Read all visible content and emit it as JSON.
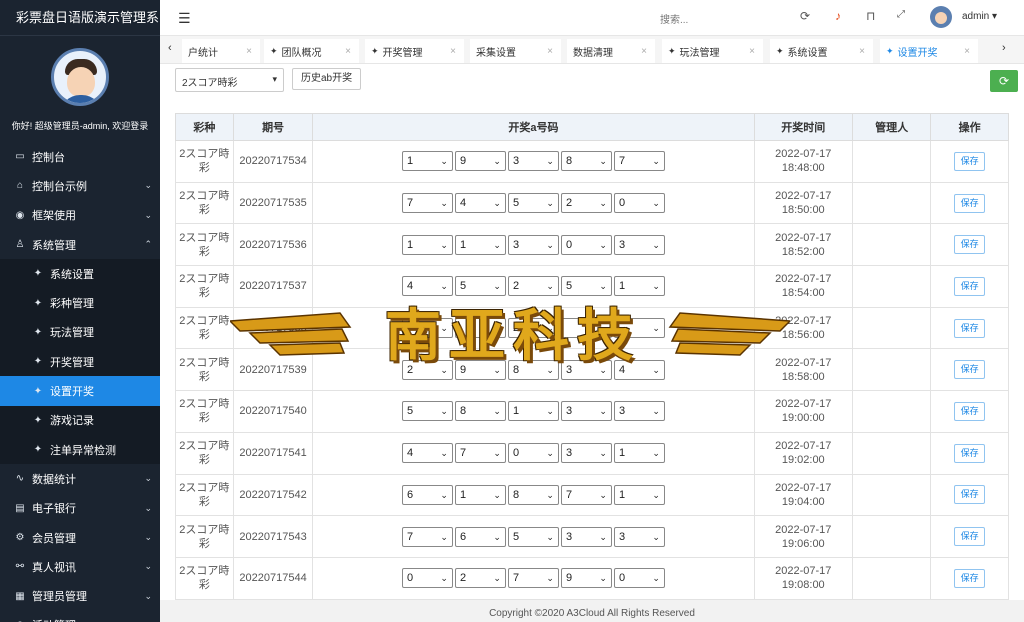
{
  "app": {
    "title": "彩票盘日语版演示管理系"
  },
  "sidebar": {
    "welcome": "你好! 超级管理员-admin, 欢迎登录",
    "items": [
      {
        "label": "控制台",
        "icon": "monitor-icon",
        "glyph": "▭",
        "arrow": ""
      },
      {
        "label": "控制台示例",
        "icon": "home-icon",
        "glyph": "⌂",
        "arrow": "⌄"
      },
      {
        "label": "框架使用",
        "icon": "toggle-icon",
        "glyph": "◉",
        "arrow": "⌄"
      },
      {
        "label": "系统管理",
        "icon": "user-icon",
        "glyph": "♙",
        "arrow": "⌃"
      },
      {
        "label": "系统设置",
        "icon": "gear-icon",
        "glyph": "✦",
        "arrow": "",
        "sub": true
      },
      {
        "label": "彩种管理",
        "icon": "gear-icon",
        "glyph": "✦",
        "arrow": "",
        "sub": true
      },
      {
        "label": "玩法管理",
        "icon": "gear-icon",
        "glyph": "✦",
        "arrow": "",
        "sub": true
      },
      {
        "label": "开奖管理",
        "icon": "gear-icon",
        "glyph": "✦",
        "arrow": "",
        "sub": true
      },
      {
        "label": "设置开奖",
        "icon": "gear-icon",
        "glyph": "✦",
        "arrow": "",
        "sub": true,
        "active": true
      },
      {
        "label": "游戏记录",
        "icon": "gear-icon",
        "glyph": "✦",
        "arrow": "",
        "sub": true
      },
      {
        "label": "注单异常检测",
        "icon": "gear-icon",
        "glyph": "✦",
        "arrow": "",
        "sub": true
      },
      {
        "label": "数据统计",
        "icon": "pulse-icon",
        "glyph": "∿",
        "arrow": "⌄"
      },
      {
        "label": "电子银行",
        "icon": "bank-icon",
        "glyph": "▤",
        "arrow": "⌄"
      },
      {
        "label": "会员管理",
        "icon": "settings-icon",
        "glyph": "⚙",
        "arrow": "⌄"
      },
      {
        "label": "真人视讯",
        "icon": "bike-icon",
        "glyph": "⚯",
        "arrow": "⌄"
      },
      {
        "label": "管理员管理",
        "icon": "grid-icon",
        "glyph": "▦",
        "arrow": "⌄"
      },
      {
        "label": "活动管理",
        "icon": "globe-icon",
        "glyph": "◍",
        "arrow": "⌄"
      }
    ]
  },
  "header": {
    "menu_toggle": "☰",
    "search_placeholder": "搜索...",
    "username": "admin ▾"
  },
  "tabs": [
    {
      "label": "户统计",
      "glyph": ""
    },
    {
      "label": "团队概况",
      "glyph": "✦"
    },
    {
      "label": "开奖管理",
      "glyph": "✦"
    },
    {
      "label": "采集设置",
      "glyph": ""
    },
    {
      "label": "数据清理",
      "glyph": ""
    },
    {
      "label": "玩法管理",
      "glyph": "✦"
    },
    {
      "label": "系统设置",
      "glyph": "✦"
    },
    {
      "label": "设置开奖",
      "glyph": "✦",
      "active": true
    }
  ],
  "toolbar": {
    "lottery_select": "2スコア時彩",
    "history_button": "历史ab开奖"
  },
  "table": {
    "headers": [
      "彩种",
      "期号",
      "开奖a号码",
      "开奖时间",
      "管理人",
      "操作"
    ],
    "rows": [
      {
        "lottery": "2スコア時彩",
        "issue": "20220717534",
        "balls": [
          "1",
          "9",
          "3",
          "8",
          "7"
        ],
        "time": "2022-07-17 18:48:00",
        "admin": "",
        "action": "保存"
      },
      {
        "lottery": "2スコア時彩",
        "issue": "20220717535",
        "balls": [
          "7",
          "4",
          "5",
          "2",
          "0"
        ],
        "time": "2022-07-17 18:50:00",
        "admin": "",
        "action": "保存"
      },
      {
        "lottery": "2スコア時彩",
        "issue": "20220717536",
        "balls": [
          "1",
          "1",
          "3",
          "0",
          "3"
        ],
        "time": "2022-07-17 18:52:00",
        "admin": "",
        "action": "保存"
      },
      {
        "lottery": "2スコア時彩",
        "issue": "20220717537",
        "balls": [
          "4",
          "5",
          "2",
          "5",
          "1"
        ],
        "time": "2022-07-17 18:54:00",
        "admin": "",
        "action": "保存"
      },
      {
        "lottery": "2スコア時彩",
        "issue": "20220717538",
        "balls": [
          "",
          "",
          "2",
          "",
          ""
        ],
        "time": "2022-07-17 18:56:00",
        "admin": "",
        "action": "保存"
      },
      {
        "lottery": "2スコア時彩",
        "issue": "20220717539",
        "balls": [
          "2",
          "9",
          "8",
          "3",
          "4"
        ],
        "time": "2022-07-17 18:58:00",
        "admin": "",
        "action": "保存"
      },
      {
        "lottery": "2スコア時彩",
        "issue": "20220717540",
        "balls": [
          "5",
          "8",
          "1",
          "3",
          "3"
        ],
        "time": "2022-07-17 19:00:00",
        "admin": "",
        "action": "保存"
      },
      {
        "lottery": "2スコア時彩",
        "issue": "20220717541",
        "balls": [
          "4",
          "7",
          "0",
          "3",
          "1"
        ],
        "time": "2022-07-17 19:02:00",
        "admin": "",
        "action": "保存"
      },
      {
        "lottery": "2スコア時彩",
        "issue": "20220717542",
        "balls": [
          "6",
          "1",
          "8",
          "7",
          "1"
        ],
        "time": "2022-07-17 19:04:00",
        "admin": "",
        "action": "保存"
      },
      {
        "lottery": "2スコア時彩",
        "issue": "20220717543",
        "balls": [
          "7",
          "6",
          "5",
          "3",
          "3"
        ],
        "time": "2022-07-17 19:06:00",
        "admin": "",
        "action": "保存"
      },
      {
        "lottery": "2スコア時彩",
        "issue": "20220717544",
        "balls": [
          "0",
          "2",
          "7",
          "9",
          "0"
        ],
        "time": "2022-07-17 19:08:00",
        "admin": "",
        "action": "保存"
      }
    ]
  },
  "footer": {
    "copyright": "Copyright ©2020 A3Cloud All Rights Reserved"
  },
  "watermark": {
    "text": "南亚科技"
  },
  "colors": {
    "sidebar_bg": "#1b2430",
    "accent": "#1e88e5",
    "refresh": "#4caf50",
    "watermark": "#e0a81c"
  }
}
